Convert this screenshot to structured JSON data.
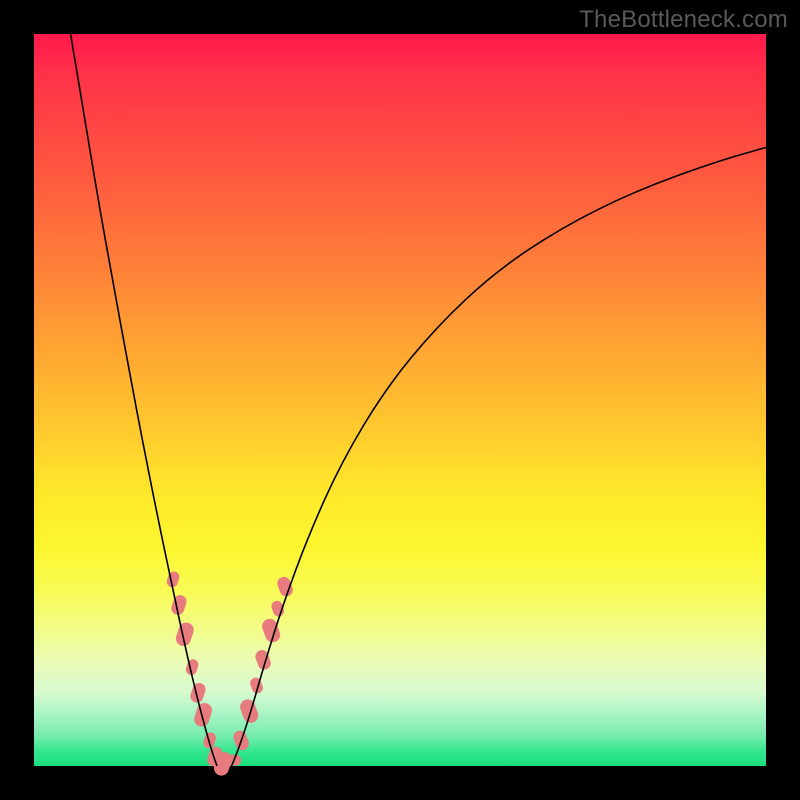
{
  "watermark": "TheBottleneck.com",
  "colors": {
    "background": "#000000",
    "blob": "#e77b7e",
    "curve": "#000000"
  },
  "chart_data": {
    "type": "line",
    "title": "",
    "xlabel": "",
    "ylabel": "",
    "xlim": [
      0,
      100
    ],
    "ylim": [
      0,
      100
    ],
    "note": "No axis ticks or numeric labels are shown; values are estimated in plot-percentage coordinates (0 = left/bottom, 100 = right/top).",
    "series": [
      {
        "name": "left-branch",
        "x": [
          5,
          7,
          9,
          11,
          13,
          15,
          17,
          19,
          20.5,
          22,
          23.3,
          24.3,
          25
        ],
        "y": [
          100,
          88,
          76,
          65,
          54,
          43.5,
          33.5,
          24,
          17,
          10.5,
          5.5,
          2,
          0
        ]
      },
      {
        "name": "right-branch",
        "x": [
          27,
          28,
          29.5,
          31.5,
          34,
          37.5,
          42,
          48,
          55,
          63,
          72,
          82,
          93,
          100
        ],
        "y": [
          0,
          2.5,
          7,
          14,
          22,
          31.5,
          41.5,
          51.5,
          60,
          67.5,
          73.5,
          78.5,
          82.5,
          84.5
        ]
      }
    ],
    "markers": {
      "description": "Salmon-colored rounded blobs along lower portion of V",
      "points_pct": [
        {
          "x": 19.0,
          "y": 25.5
        },
        {
          "x": 19.8,
          "y": 22.0
        },
        {
          "x": 20.6,
          "y": 18.0
        },
        {
          "x": 21.6,
          "y": 13.5
        },
        {
          "x": 22.4,
          "y": 10.0
        },
        {
          "x": 23.1,
          "y": 7.0
        },
        {
          "x": 24.0,
          "y": 3.5
        },
        {
          "x": 24.7,
          "y": 1.3
        },
        {
          "x": 25.8,
          "y": 0.3
        },
        {
          "x": 27.2,
          "y": 0.8
        },
        {
          "x": 28.3,
          "y": 3.5
        },
        {
          "x": 29.4,
          "y": 7.5
        },
        {
          "x": 30.4,
          "y": 11.0
        },
        {
          "x": 31.3,
          "y": 14.5
        },
        {
          "x": 32.4,
          "y": 18.5
        },
        {
          "x": 33.3,
          "y": 21.5
        },
        {
          "x": 34.3,
          "y": 24.5
        }
      ]
    }
  }
}
